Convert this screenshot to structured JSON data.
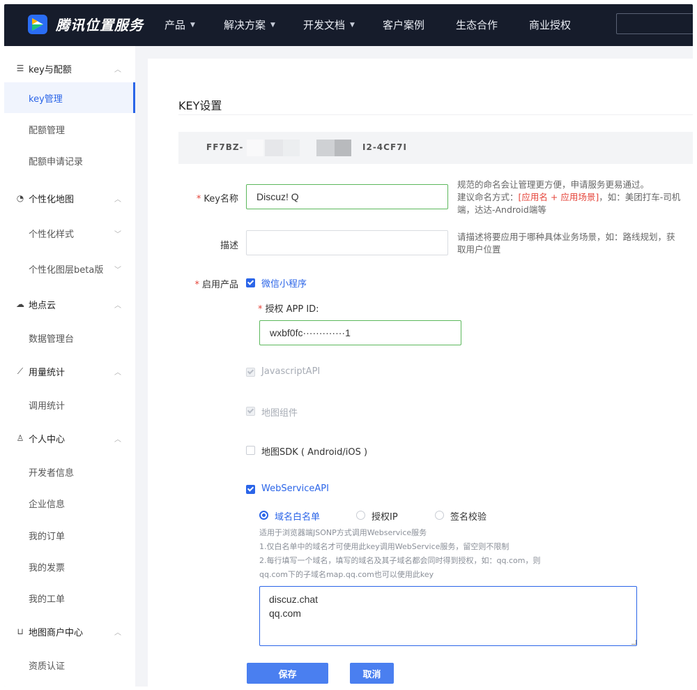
{
  "brand": {
    "name": "腾讯位置服务",
    "logo_icon": "tencent-map-logo-icon"
  },
  "nav": {
    "items": [
      {
        "label": "产品",
        "has_caret": true
      },
      {
        "label": "解决方案",
        "has_caret": true
      },
      {
        "label": "开发文档",
        "has_caret": true
      },
      {
        "label": "客户案例",
        "has_caret": false
      },
      {
        "label": "生态合作",
        "has_caret": false
      },
      {
        "label": "商业授权",
        "has_caret": false
      }
    ],
    "caret": "▼"
  },
  "sidebar": {
    "groups": [
      {
        "label": "key与配额",
        "icon": "list-icon",
        "icon_glyph": "☰",
        "items": [
          {
            "label": "key管理",
            "active": true
          },
          {
            "label": "配额管理"
          },
          {
            "label": "配额申请记录"
          }
        ]
      },
      {
        "label": "个性化地图",
        "icon": "palette-icon",
        "icon_glyph": "◔",
        "items": [
          {
            "label": "个性化样式",
            "has_caret": true
          },
          {
            "label": "个性化图层beta版",
            "has_caret": true
          }
        ]
      },
      {
        "label": "地点云",
        "icon": "cloud-icon",
        "icon_glyph": "☁",
        "items": [
          {
            "label": "数据管理台"
          }
        ]
      },
      {
        "label": "用量统计",
        "icon": "chart-icon",
        "icon_glyph": "⟋",
        "items": [
          {
            "label": "调用统计"
          }
        ]
      },
      {
        "label": "个人中心",
        "icon": "user-icon",
        "icon_glyph": "♙",
        "items": [
          {
            "label": "开发者信息"
          },
          {
            "label": "企业信息"
          },
          {
            "label": "我的订单"
          },
          {
            "label": "我的发票"
          },
          {
            "label": "我的工单"
          }
        ]
      },
      {
        "label": "地图商户中心",
        "icon": "cart-icon",
        "icon_glyph": "⊔",
        "items": [
          {
            "label": "资质认证"
          }
        ]
      }
    ],
    "caret_up": "︿",
    "caret_down": "﹀"
  },
  "main": {
    "title": "KEY设置",
    "key_prefix": "FF7BZ-",
    "key_suffix": "I2-4CF7I",
    "key_name": {
      "label": "Key名称",
      "value": "Discuz! Q",
      "hint_line1": "规范的命名会让管理更方便，申请服务更易通过。",
      "hint_line2_prefix": "建议命名方式：",
      "hint_line2_red": "[应用名 + 应用场景]",
      "hint_line2_suffix": "，如：美团打车-司机",
      "hint_line3": "端，达达-Android端等"
    },
    "description": {
      "label": "描述",
      "value": "",
      "hint_line1": "请描述将要应用于哪种具体业务场景，如：路线规划，获",
      "hint_line2": "取用户位置"
    },
    "products": {
      "label": "启用产品",
      "wechat_miniprogram": {
        "label": "微信小程序",
        "checked": true
      },
      "app_id": {
        "label": "授权 APP ID:",
        "value": "wxbf0fc·············1"
      },
      "javascript_api": {
        "label": "JavascriptAPI",
        "checked": true,
        "disabled": true
      },
      "map_component": {
        "label": "地图组件",
        "checked": true,
        "disabled": true
      },
      "map_sdk": {
        "label": "地图SDK ( Android/iOS )",
        "checked": false
      },
      "webservice_api": {
        "label": "WebServiceAPI",
        "checked": true
      }
    },
    "auth_modes": {
      "options": [
        {
          "label": "域名白名单",
          "selected": true
        },
        {
          "label": "授权IP",
          "selected": false
        },
        {
          "label": "签名校验",
          "selected": false
        }
      ],
      "note_lines": [
        "适用于浏览器端JSONP方式调用Webservice服务",
        "1.仅白名单中的域名才可使用此key调用WebService服务，留空则不限制",
        "2.每行填写一个域名，填写的域名及其子域名都会同时得到授权，如：qq.com，则",
        "qq.com下的子域名map.qq.com也可以使用此key"
      ],
      "domains": "discuz.chat\nqq.com"
    },
    "buttons": {
      "save": "保存",
      "cancel": "取消"
    }
  },
  "colors": {
    "accent": "#2b65e8",
    "topbar": "#161c2b",
    "required": "#e5443a",
    "valid_border": "#5cb85c"
  }
}
